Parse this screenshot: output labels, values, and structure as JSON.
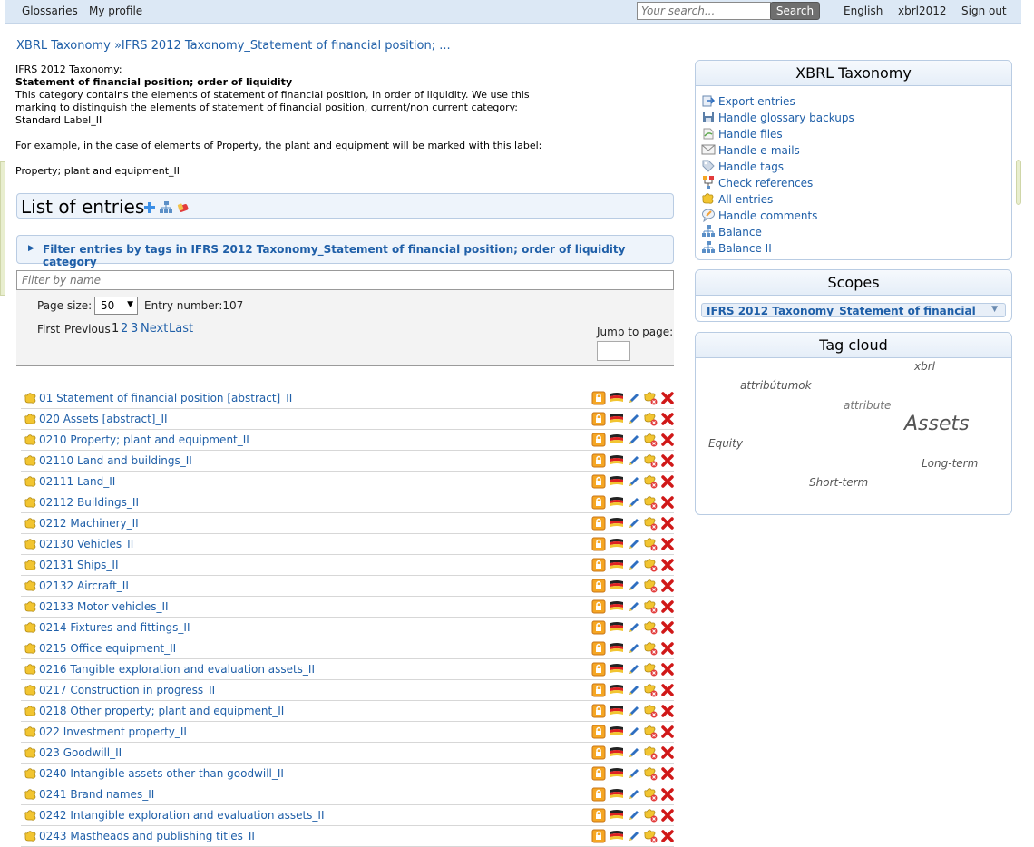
{
  "topbar": {
    "nav": [
      "Glossaries",
      "My profile"
    ],
    "search_placeholder": "Your search...",
    "search_button": "Search",
    "language": "English",
    "user": "xbrl2012",
    "signout": "Sign out"
  },
  "breadcrumb": {
    "root": "XBRL Taxonomy",
    "separator": "»",
    "current": "IFRS 2012 Taxonomy_Statement of financial position; ..."
  },
  "description": {
    "line1": "IFRS 2012 Taxonomy:",
    "title": "Statement of financial position; order of liquidity",
    "line3": "This category contains the elements of statement of financial position, in order of liquidity. We use this",
    "line4": "marking to distinguish the elements of statement of financial position, current/non current category:",
    "line5": "Standard Label_II",
    "line6": "For example, in the case of elements of Property, the plant and equipment will be marked with this label:",
    "line7": "Property; plant and equipment_II"
  },
  "list": {
    "title": "List of entries",
    "filter_tags": "Filter entries by tags in IFRS 2012 Taxonomy_Statement of financial position; order of liquidity category",
    "filter_placeholder": "Filter by name",
    "page_size_label": "Page size:",
    "page_size_value": "50",
    "entry_number": "Entry number:107",
    "first": "First",
    "previous": "Previous",
    "current_page": "1",
    "page2": "2",
    "page3": "3",
    "next": "Next",
    "last": "Last",
    "jump_label": "Jump to page:"
  },
  "entries": [
    "01 Statement of financial position [abstract]_II",
    "020 Assets [abstract]_II",
    "0210 Property; plant and equipment_II",
    "02110 Land and buildings_II",
    "02111 Land_II",
    "02112 Buildings_II",
    "0212 Machinery_II",
    "02130 Vehicles_II",
    "02131 Ships_II",
    "02132 Aircraft_II",
    "02133 Motor vehicles_II",
    "0214 Fixtures and fittings_II",
    "0215 Office equipment_II",
    "0216 Tangible exploration and evaluation assets_II",
    "0217 Construction in progress_II",
    "0218 Other property; plant and equipment_II",
    "022 Investment property_II",
    "023 Goodwill_II",
    "0240 Intangible assets other than goodwill_II",
    "0241 Brand names_II",
    "0242 Intangible exploration and evaluation assets_II",
    "0243 Mastheads and publishing titles_II"
  ],
  "taxonomy_panel": {
    "title": "XBRL Taxonomy",
    "items": [
      "Export entries",
      "Handle glossary backups",
      "Handle files",
      "Handle e-mails",
      "Handle tags",
      "Check references",
      "All entries",
      "Handle comments",
      "Balance",
      "Balance II"
    ]
  },
  "scopes_panel": {
    "title": "Scopes",
    "selected": "IFRS 2012 Taxonomy_Statement of financial"
  },
  "tagcloud_panel": {
    "title": "Tag cloud",
    "tags": [
      "xbrl",
      "attribútumok",
      "attribute",
      "Assets",
      "Equity",
      "Long-term",
      "Short-term"
    ]
  },
  "colors": {
    "link": "#1f5fa8",
    "topbar": "#dce8f5",
    "panel_border": "#b9cce3"
  }
}
